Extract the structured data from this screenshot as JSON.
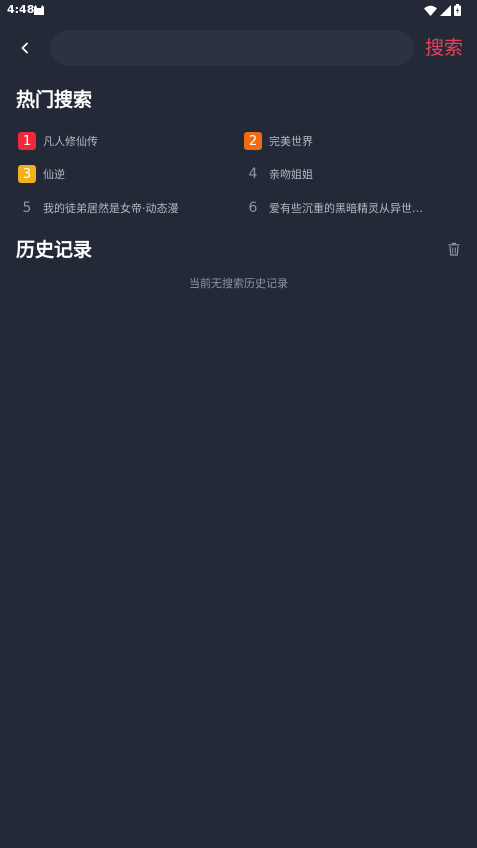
{
  "status_bar": {
    "time": "4:48",
    "icons": [
      "cat-notification-icon",
      "wifi-icon",
      "signal-icon",
      "battery-icon"
    ]
  },
  "header": {
    "search_placeholder": "",
    "search_value": "",
    "search_button_label": "搜索"
  },
  "hot_search": {
    "title": "热门搜索",
    "items": [
      {
        "rank": "1",
        "label": "凡人修仙传",
        "badge_color": "#f0283c"
      },
      {
        "rank": "2",
        "label": "完美世界",
        "badge_color": "#f06a14"
      },
      {
        "rank": "3",
        "label": "仙逆",
        "badge_color": "#f2b11a"
      },
      {
        "rank": "4",
        "label": "亲吻姐姐",
        "badge_color": ""
      },
      {
        "rank": "5",
        "label": "我的徒弟居然是女帝·动态漫",
        "badge_color": ""
      },
      {
        "rank": "6",
        "label": "爱有些沉重的黑暗精灵从异世…",
        "badge_color": ""
      }
    ]
  },
  "history": {
    "title": "历史记录",
    "empty_text": "当前无搜索历史记录",
    "clear_icon": "trash-icon"
  },
  "colors": {
    "background": "#242937",
    "search_box": "#2d3240",
    "accent": "#e9405a"
  }
}
